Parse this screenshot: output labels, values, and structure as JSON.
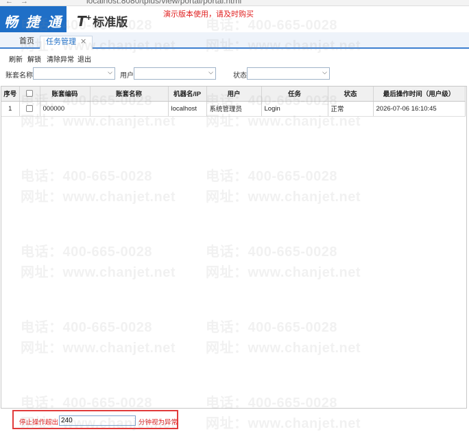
{
  "browser": {
    "url": "localhost:8080/tplus/view/portal/portal.html"
  },
  "header": {
    "logo": "畅 捷 通",
    "edition_prefix": "T",
    "edition_plus": "+",
    "edition_name": "标准版",
    "demo_note": "演示版本使用，请及时购买"
  },
  "tabs": [
    {
      "label": "首页"
    },
    {
      "label": "任务管理",
      "close": "✕"
    }
  ],
  "toolbar": {
    "refresh": "刷新",
    "unlock": "解锁",
    "clear": "清除异常",
    "exit": "退出"
  },
  "filters": {
    "account_label": "账套名称",
    "account_value": "",
    "user_label": "用户",
    "user_value": "",
    "status_label": "状态",
    "status_value": ""
  },
  "grid": {
    "columns": [
      "序号",
      "",
      "账套编码",
      "账套名称",
      "机器名/IP",
      "用户",
      "任务",
      "状态",
      "最后操作时间（用户级）"
    ],
    "rows": [
      {
        "index": "1",
        "code": "000000",
        "name": "",
        "machine": "localhost",
        "user": "系统管理员",
        "task": "Login",
        "status": "正常",
        "time": "2026-07-06 16:10:45"
      }
    ]
  },
  "watermark": {
    "phone": "电话：400-665-0028",
    "site": "网址：www.chanjet.net"
  },
  "footer": {
    "prefix": "停止操作超出",
    "minutes": "240",
    "suffix": "分钟视为异常"
  },
  "colors": {
    "brand": "#1f6fc7",
    "warning": "#e02020"
  }
}
